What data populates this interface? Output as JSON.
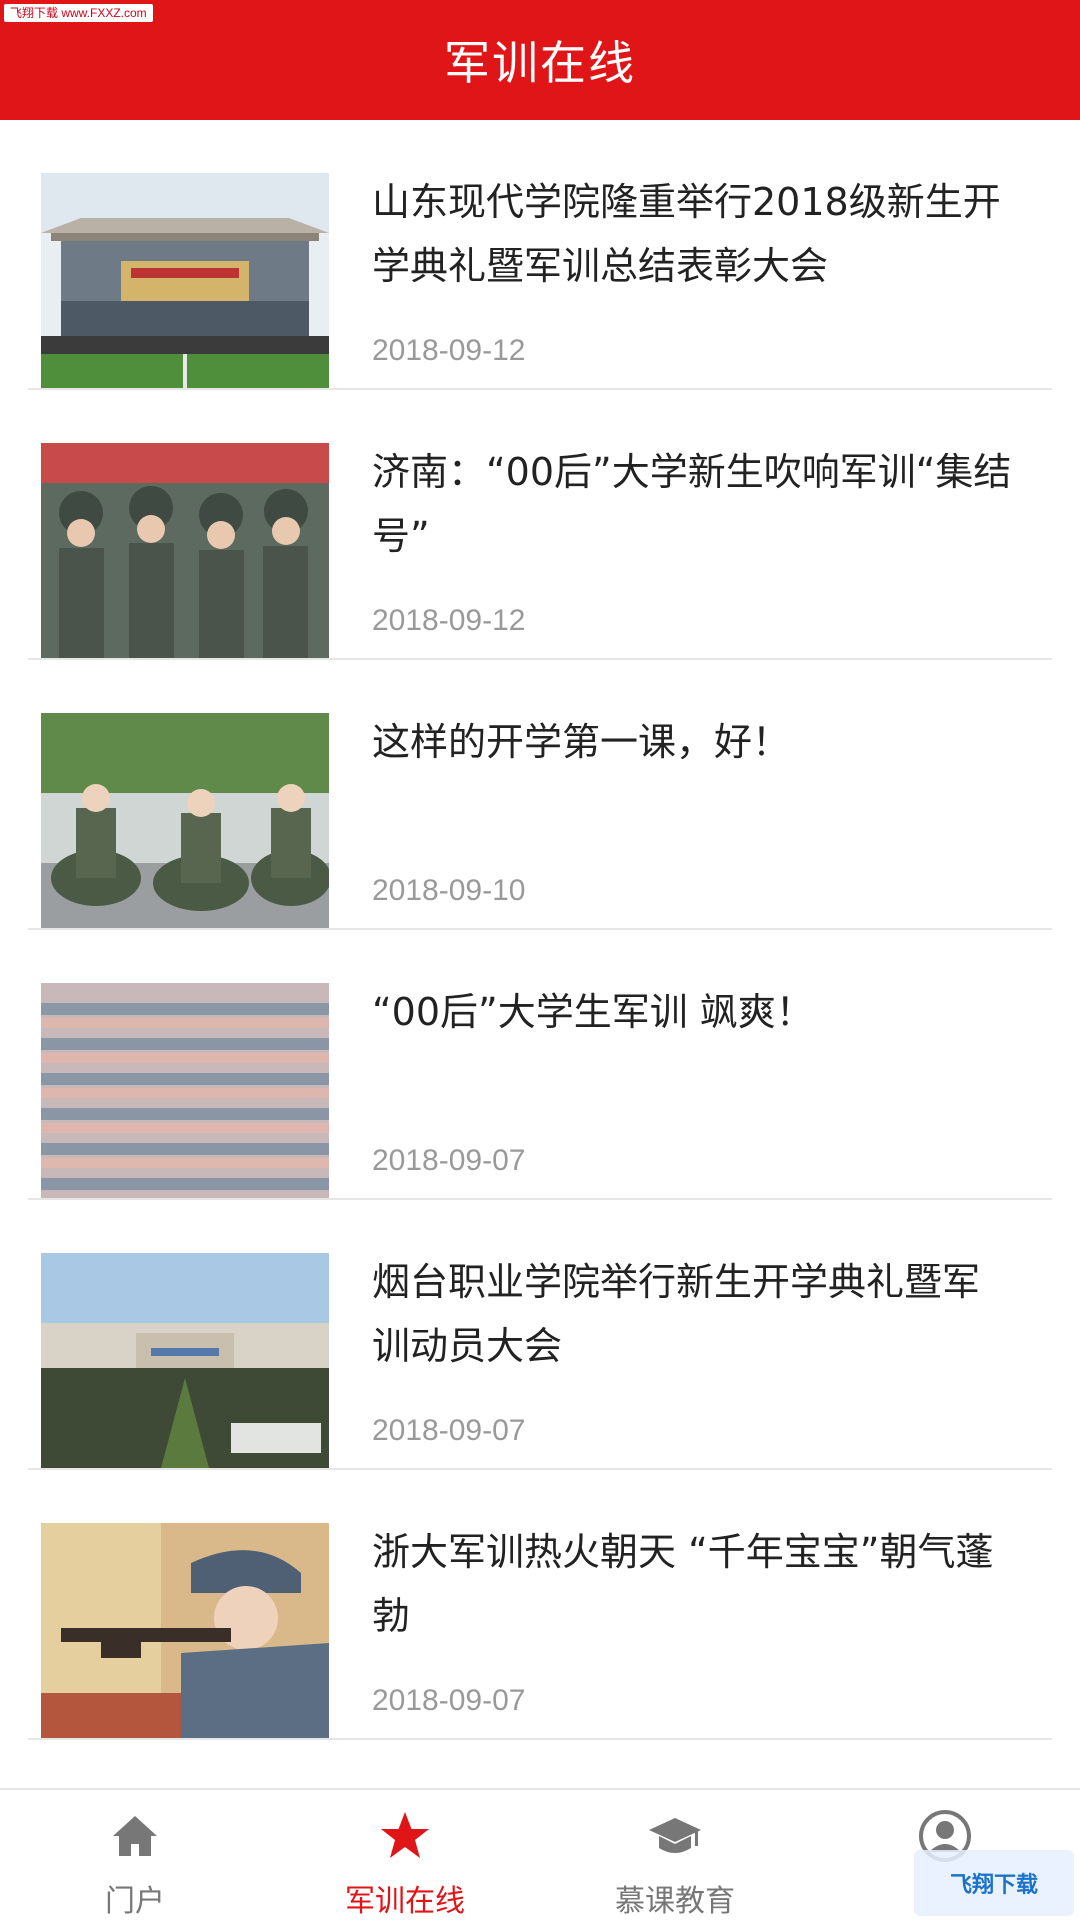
{
  "watermark_top": "飞翔下载 www.FXXZ.com",
  "header": {
    "title": "军训在线"
  },
  "colors": {
    "brand": "#e01518",
    "date": "#999999",
    "inactive_tab": "#777777"
  },
  "articles": [
    {
      "title": "山东现代学院隆重举行2018级新生开学典礼暨军训总结表彰大会",
      "date": "2018-09-12",
      "thumb": "stadium-ceremony"
    },
    {
      "title": "济南：“00后”大学新生吹响军训“集结号”",
      "date": "2018-09-12",
      "thumb": "students-in-camouflage"
    },
    {
      "title": "这样的开学第一课，好！",
      "date": "2018-09-10",
      "thumb": "girls-sitting-in-camouflage"
    },
    {
      "title": "“00后”大学生军训 飒爽！",
      "date": "2018-09-07",
      "thumb": "crowd-arms-raised"
    },
    {
      "title": "烟台职业学院举行新生开学典礼暨军训动员大会",
      "date": "2018-09-07",
      "thumb": "campus-assembly"
    },
    {
      "title": "浙大军训热火朝天 “千年宝宝”朝气蓬勃",
      "date": "2018-09-07",
      "thumb": "student-aiming-rifle"
    }
  ],
  "tabs": [
    {
      "label": "门户",
      "icon": "home-icon",
      "active": false
    },
    {
      "label": "军训在线",
      "icon": "star-icon",
      "active": true
    },
    {
      "label": "慕课教育",
      "icon": "graduation-cap-icon",
      "active": false
    },
    {
      "label": "",
      "icon": "user-icon",
      "active": false
    }
  ],
  "watermark_bottom": "飞翔下载"
}
